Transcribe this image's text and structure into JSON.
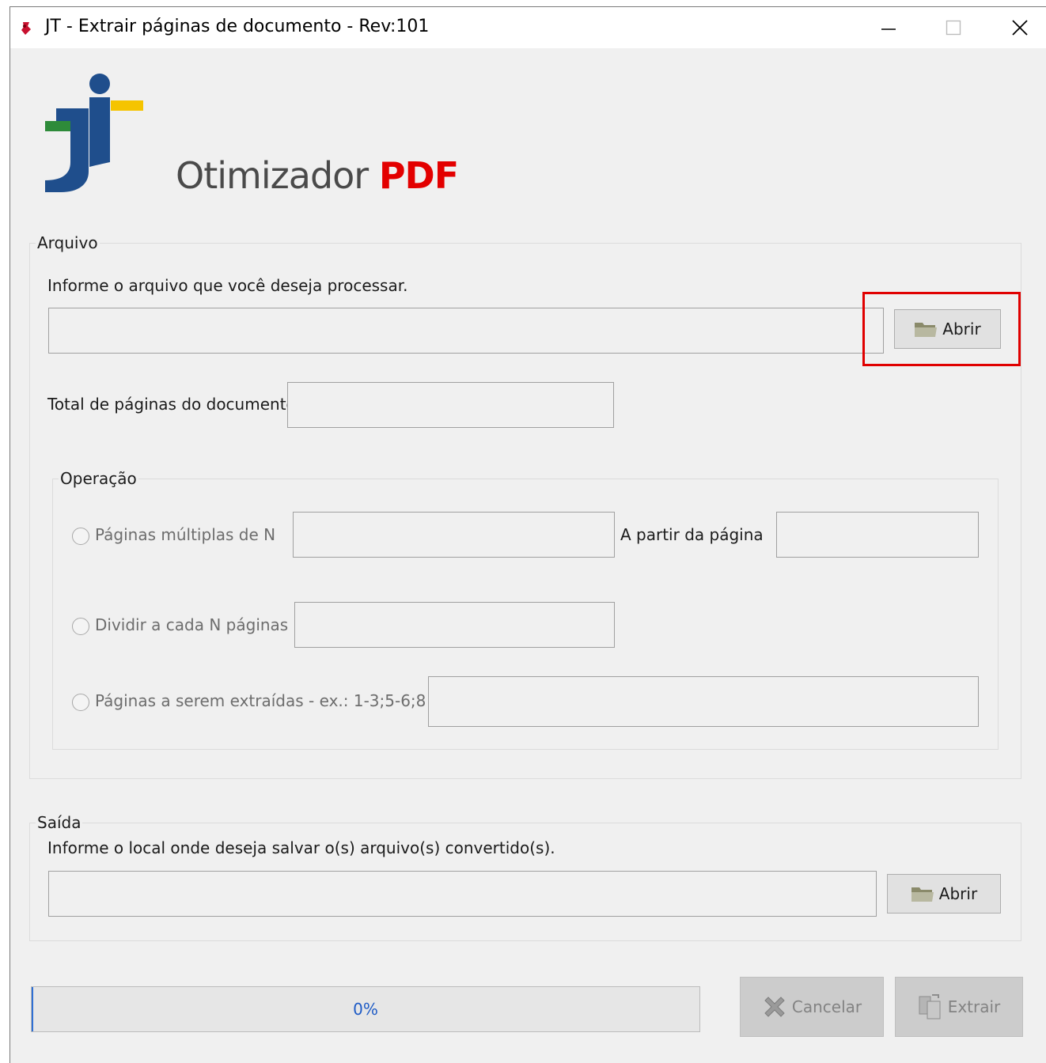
{
  "window": {
    "title": "JT - Extrair páginas de documento - Rev:101",
    "controls": {
      "minimize": "minimize-icon",
      "maximize": "maximize-icon",
      "close": "close-icon"
    }
  },
  "header": {
    "brand_main": "Otimizador",
    "brand_accent": "PDF"
  },
  "colors": {
    "accent_red": "#e30000",
    "logo_blue": "#1f4e8c",
    "logo_green": "#2e8b3a",
    "logo_yellow": "#f5c400",
    "highlight": "#e00000",
    "progress_text": "#1e5bc6"
  },
  "arquivo": {
    "legend": "Arquivo",
    "instruction": "Informe o arquivo que você deseja processar.",
    "file_value": "",
    "open_label": "Abrir",
    "total_label": "Total de páginas do documento:",
    "total_value": ""
  },
  "operacao": {
    "legend": "Operação",
    "option1": {
      "label": "Páginas múltiplas de N",
      "value": ""
    },
    "start_label": "A partir da página",
    "start_value": "",
    "option2": {
      "label": "Dividir a cada N páginas",
      "value": ""
    },
    "option3": {
      "label": "Páginas a serem extraídas - ex.: 1-3;5-6;8",
      "value": ""
    }
  },
  "saida": {
    "legend": "Saída",
    "instruction": "Informe o local onde deseja salvar o(s) arquivo(s) convertido(s).",
    "path_value": "",
    "open_label": "Abrir"
  },
  "footer": {
    "progress_percent": 0,
    "progress_text": "0%",
    "cancel_label": "Cancelar",
    "extract_label": "Extrair"
  }
}
